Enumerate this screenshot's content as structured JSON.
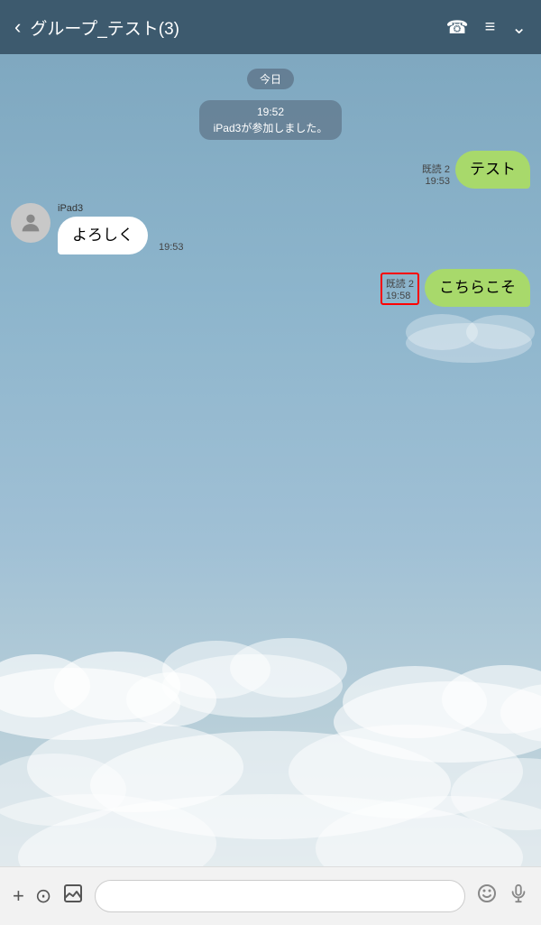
{
  "header": {
    "back_label": "‹",
    "title": "グループ_テスト(3)",
    "phone_icon": "☎",
    "menu_icon": "≡",
    "down_icon": "⌄"
  },
  "date_label": "今日",
  "system_message": {
    "time": "19:52",
    "text": "iPad3が参加しました。"
  },
  "messages": [
    {
      "id": "msg1",
      "type": "sent",
      "text": "テスト",
      "read": "既読 2",
      "time": "19:53",
      "highlighted": false
    },
    {
      "id": "msg2",
      "type": "received",
      "sender": "iPad3",
      "text": "よろしく",
      "time": "19:53",
      "highlighted": false
    },
    {
      "id": "msg3",
      "type": "sent",
      "text": "こちらこそ",
      "read": "既読 2",
      "time": "19:58",
      "highlighted": true
    }
  ],
  "toolbar": {
    "plus_icon": "+",
    "camera_icon": "⊙",
    "image_icon": "🖼",
    "input_placeholder": "",
    "emoji_icon": "☺",
    "mic_icon": "🎤"
  }
}
